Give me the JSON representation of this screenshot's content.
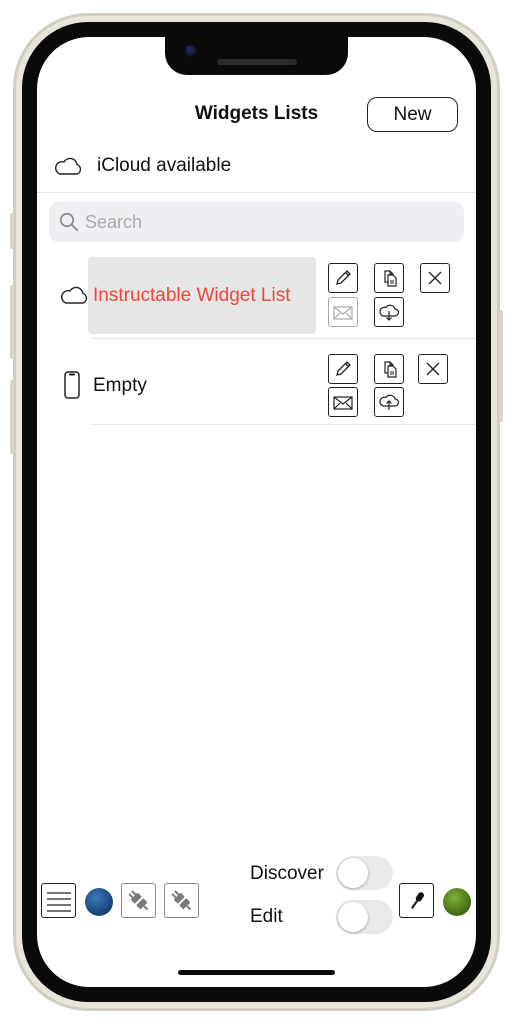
{
  "header": {
    "title": "Widgets Lists",
    "new_label": "New"
  },
  "icloud": {
    "status": "iCloud available"
  },
  "search": {
    "placeholder": "Search",
    "value": ""
  },
  "lists": [
    {
      "label": "Instructable Widget List",
      "storage_icon": "cloud-icon",
      "color": "#f0453a",
      "highlighted": true
    },
    {
      "label": "Empty",
      "storage_icon": "iphone-icon",
      "color": "#111111",
      "highlighted": false
    }
  ],
  "bottom": {
    "discover_label": "Discover",
    "edit_label": "Edit",
    "discover_on": false,
    "edit_on": false,
    "status_dot_left_color": "#1e4f82",
    "status_dot_right_color": "#4f7a1a"
  },
  "colors": {
    "accent_red": "#f0453a",
    "toggle_off": "#e9e9eb",
    "search_bg": "#efeff3"
  }
}
